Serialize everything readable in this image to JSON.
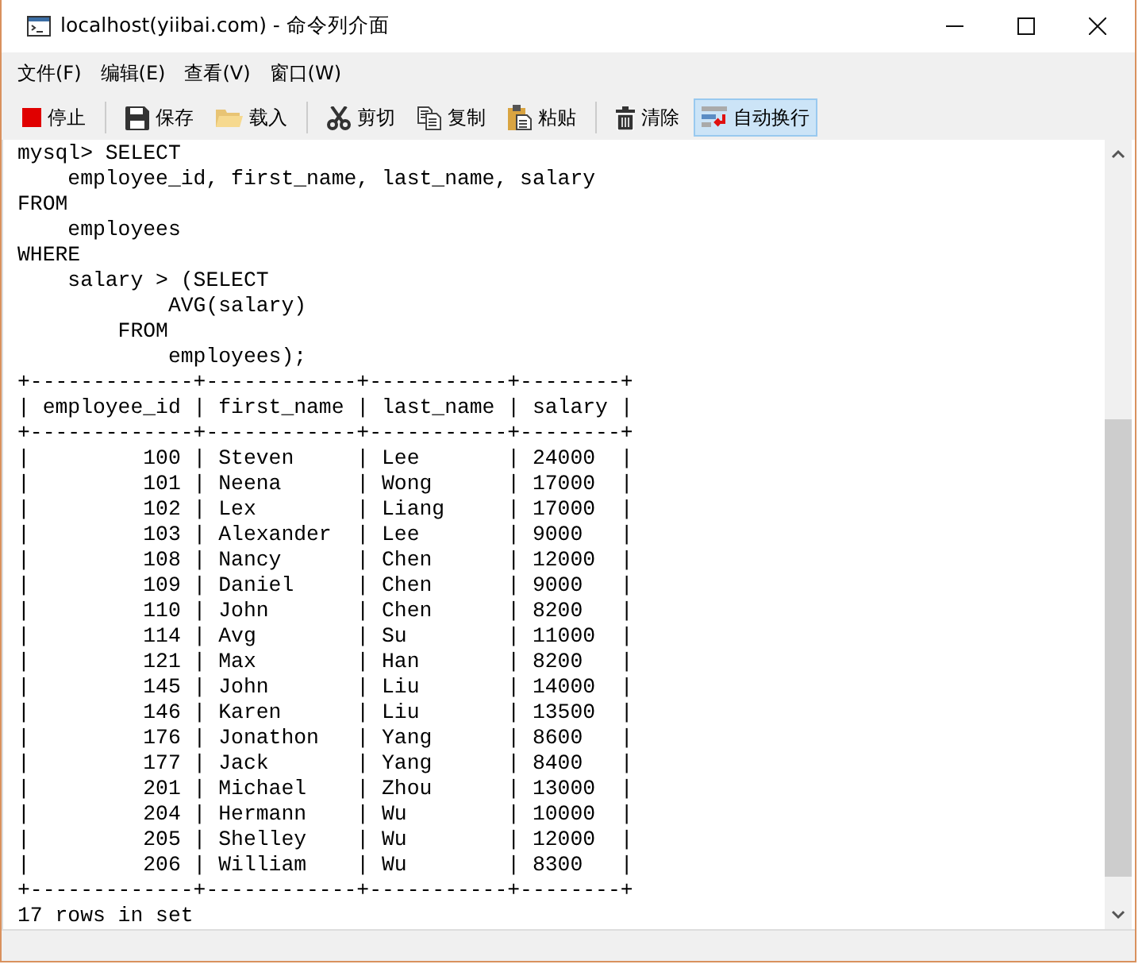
{
  "window": {
    "title": "localhost(yiibai.com) - 命令列介面"
  },
  "menu": [
    "文件(F)",
    "编辑(E)",
    "查看(V)",
    "窗口(W)"
  ],
  "toolbar": [
    [
      {
        "kind": "stop",
        "label": "停止",
        "on": false
      }
    ],
    [
      {
        "kind": "save",
        "label": "保存",
        "on": false
      },
      {
        "kind": "open",
        "label": "载入",
        "on": false
      }
    ],
    [
      {
        "kind": "cut",
        "label": "剪切",
        "on": false
      },
      {
        "kind": "copy",
        "label": "复制",
        "on": false
      },
      {
        "kind": "paste",
        "label": "粘贴",
        "on": false
      }
    ],
    [
      {
        "kind": "clear",
        "label": "清除",
        "on": false
      },
      {
        "kind": "wrap",
        "label": "自动换行",
        "on": true
      }
    ]
  ],
  "console": {
    "lines": [
      "mysql> SELECT",
      "    employee_id, first_name, last_name, salary",
      "FROM",
      "    employees",
      "WHERE",
      "    salary > (SELECT",
      "            AVG(salary)",
      "        FROM",
      "            employees);",
      "+-------------+------------+-----------+--------+",
      "| employee_id | first_name | last_name | salary |",
      "+-------------+------------+-----------+--------+",
      "|         100 | Steven     | Lee       | 24000  |",
      "|         101 | Neena      | Wong      | 17000  |",
      "|         102 | Lex        | Liang     | 17000  |",
      "|         103 | Alexander  | Lee       | 9000   |",
      "|         108 | Nancy      | Chen      | 12000  |",
      "|         109 | Daniel     | Chen      | 9000   |",
      "|         110 | John       | Chen      | 8200   |",
      "|         114 | Avg        | Su        | 11000  |",
      "|         121 | Max        | Han       | 8200   |",
      "|         145 | John       | Liu       | 14000  |",
      "|         146 | Karen      | Liu       | 13500  |",
      "|         176 | Jonathon   | Yang      | 8600   |",
      "|         177 | Jack       | Yang      | 8400   |",
      "|         201 | Michael    | Zhou      | 13000  |",
      "|         204 | Hermann    | Wu        | 10000  |",
      "|         205 | Shelley    | Wu        | 12000  |",
      "|         206 | William    | Wu        | 8300   |",
      "+-------------+------------+-----------+--------+",
      "17 rows in set"
    ]
  }
}
